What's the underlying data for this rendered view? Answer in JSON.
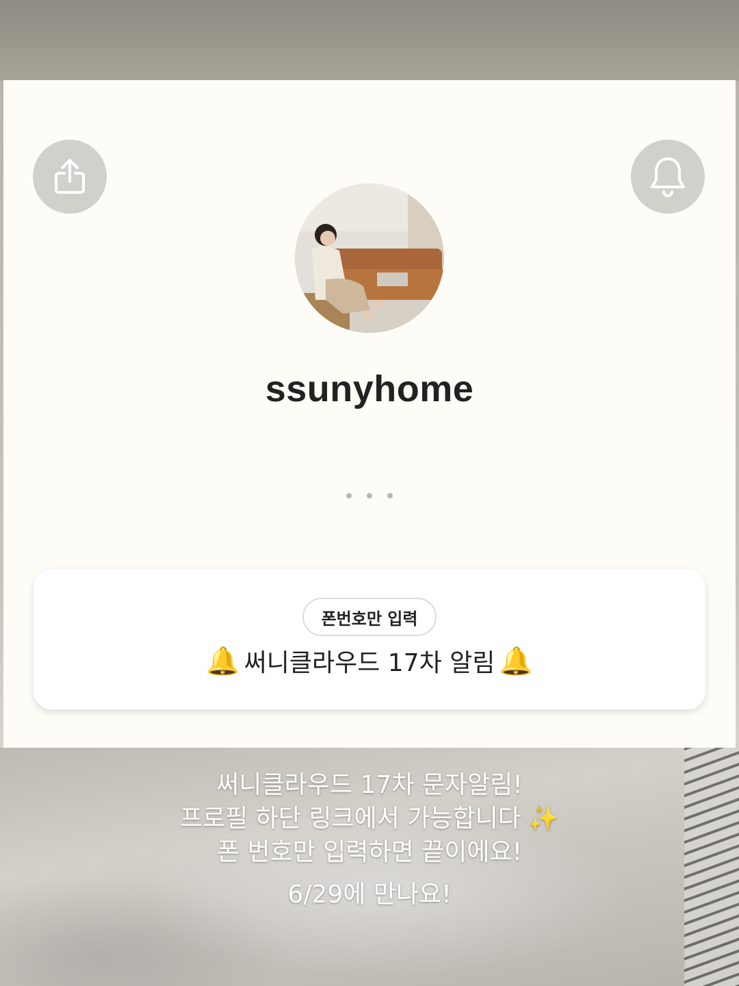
{
  "profile": {
    "username": "ssunyhome",
    "avatar_icon": "profile-photo-woman-on-sofa"
  },
  "header": {
    "share_icon": "share-icon",
    "bell_icon": "bell-icon"
  },
  "pagination": {
    "dot_count": 3
  },
  "link_card": {
    "badge": "폰번호만 입력",
    "title": "써니클라우드 17차 알림",
    "title_emoji": "🔔"
  },
  "caption": {
    "line1": "써니클라우드 17차 문자알림!",
    "line2": "프로필 하단 링크에서 가능합니다",
    "line2_emoji": "✨",
    "line3": "폰 번호만 입력하면 끝이에요!",
    "line4": "6/29에 만나요!"
  },
  "colors": {
    "card_bg": "#fdfcf6",
    "button_bg": "#d1d0cb",
    "text_dark": "#222222"
  }
}
